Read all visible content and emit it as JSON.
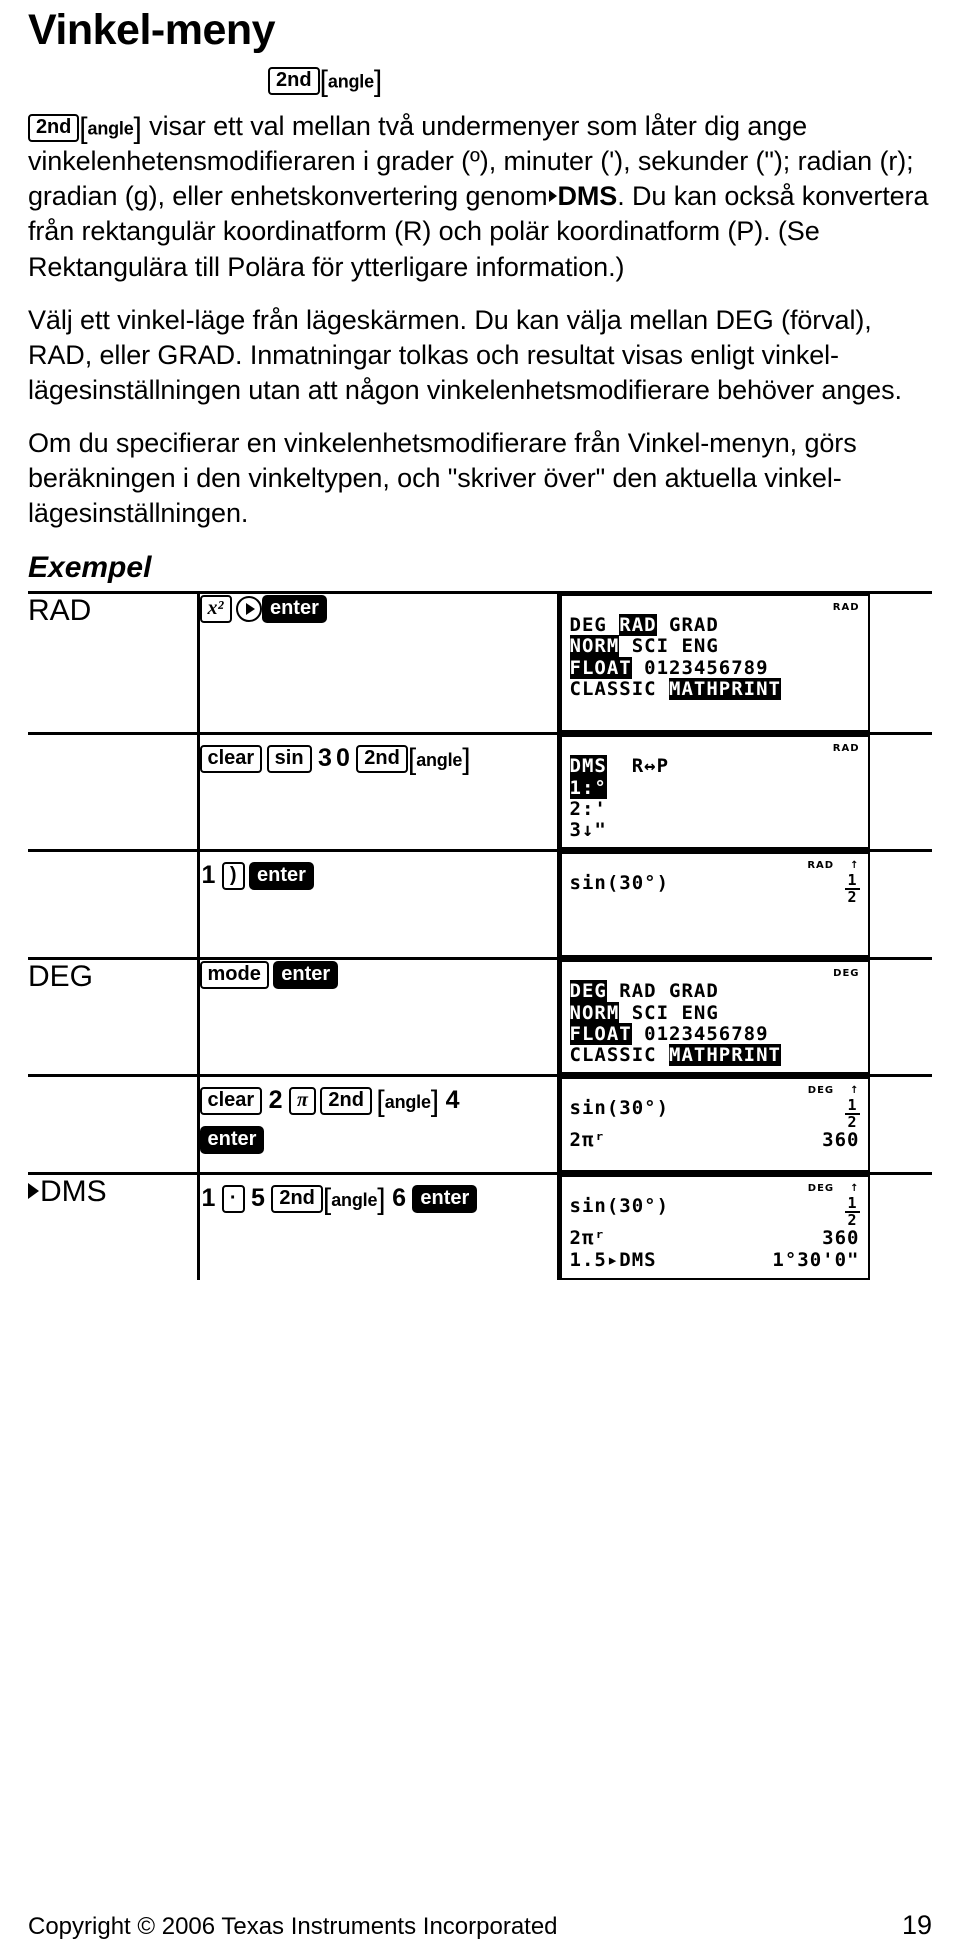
{
  "document": {
    "title": "Vinkel-meny",
    "exempel_heading": "Exempel"
  },
  "keys": {
    "second": "2nd",
    "angle": "angle",
    "x_squared": "x²",
    "enter": "enter",
    "clear": "clear",
    "sin": "sin",
    "mode": "mode",
    "pi": "π",
    "right_paren": ")",
    "decimal_point": "·",
    "digit_3": "3",
    "digit_0": "0",
    "digit_1": "1",
    "digit_2": "2",
    "digit_4": "4",
    "digit_5": "5",
    "digit_6": "6"
  },
  "body": {
    "p1_lead_text": " visar ett val mellan två undermenyer som låter dig ange vinkelenhetensmodifieraren i grader (º), minuter ('), sekunder (\"); radian (r); gradian (g), eller enhetskonvertering genom",
    "p1_dms": "DMS",
    "p1_rest": ". Du kan också konvertera från rektangulär koordinatform (R) och polär koordinatform (P). (Se Rektangulära till Polära för ytterligare information.)",
    "p2": "Välj ett vinkel-läge från lägeskärmen. Du kan välja mellan DEG (förval), RAD, eller GRAD. Inmatningar tolkas och resultat visas enligt vinkel-lägesinställningen utan att någon vinkelenhetsmodifierare behöver anges.",
    "p3": "Om du specifierar en vinkelenhetsmodifierare från Vinkel-menyn, görs beräkningen i den vinkeltypen, och \"skriver över\" den aktuella vinkel-lägesinställningen."
  },
  "examples": {
    "rows": [
      {
        "mode_label": "RAD",
        "keys_label": "x² ▶ enter",
        "screen": {
          "status": "RAD",
          "status_up": "",
          "type": "mode-screen",
          "lines": [
            [
              {
                "t": "DEG ",
                "inv": false
              },
              {
                "t": "RAD",
                "inv": true
              },
              {
                "t": " GRAD",
                "inv": false
              }
            ],
            [
              {
                "t": "NORM",
                "inv": true
              },
              {
                "t": " SCI ENG",
                "inv": false
              }
            ],
            [
              {
                "t": "FLOAT",
                "inv": true
              },
              {
                "t": " 0123456789",
                "inv": false
              }
            ],
            [
              {
                "t": "CLASSIC ",
                "inv": false
              },
              {
                "t": "MATHPRINT",
                "inv": true
              }
            ]
          ]
        }
      },
      {
        "mode_label": "",
        "keys_label": "clear sin 3 0 2nd [angle]",
        "screen": {
          "status": "RAD",
          "status_up": "",
          "type": "menu-screen",
          "lines": [
            [
              {
                "t": "DMS",
                "inv": true
              },
              {
                "t": "  R↔P",
                "inv": false
              }
            ],
            [
              {
                "t": "1:°",
                "inv": true
              }
            ],
            [
              {
                "t": "2:'",
                "inv": false
              }
            ],
            [
              {
                "t": "3↓\"",
                "inv": false
              }
            ]
          ]
        }
      },
      {
        "mode_label": "",
        "keys_label": "1 ) enter",
        "screen": {
          "status": "RAD",
          "status_up": "↑",
          "type": "calc-screen",
          "entries": [
            {
              "expr": "sin(30°)",
              "result_num": "1",
              "result_den": "2",
              "result": ""
            }
          ]
        }
      },
      {
        "mode_label": "DEG",
        "keys_label": "mode enter",
        "screen": {
          "status": "DEG",
          "status_up": "",
          "type": "mode-screen",
          "lines": [
            [
              {
                "t": "DEG",
                "inv": true
              },
              {
                "t": " RAD GRAD",
                "inv": false
              }
            ],
            [
              {
                "t": "NORM",
                "inv": true
              },
              {
                "t": " SCI ENG",
                "inv": false
              }
            ],
            [
              {
                "t": "FLOAT",
                "inv": true
              },
              {
                "t": " 0123456789",
                "inv": false
              }
            ],
            [
              {
                "t": "CLASSIC ",
                "inv": false
              },
              {
                "t": "MATHPRINT",
                "inv": true
              }
            ]
          ]
        }
      },
      {
        "mode_label": "",
        "keys_label": "clear 2 π 2nd [angle] 4 enter",
        "screen": {
          "status": "DEG",
          "status_up": "↑",
          "type": "calc-screen",
          "entries": [
            {
              "expr": "sin(30°)",
              "result_num": "1",
              "result_den": "2",
              "result": ""
            },
            {
              "expr": "2πʳ",
              "result": "360"
            }
          ]
        }
      },
      {
        "mode_label": "▶DMS",
        "keys_label": "1 · 5 2nd [angle] 6 enter",
        "screen": {
          "status": "DEG",
          "status_up": "↑",
          "type": "calc-screen",
          "entries": [
            {
              "expr": "sin(30°)",
              "result_num": "1",
              "result_den": "2",
              "result": ""
            },
            {
              "expr": "2πʳ",
              "result": "360"
            },
            {
              "expr": "1.5▸DMS",
              "result": "1°30'0\""
            }
          ]
        }
      }
    ]
  },
  "footer": {
    "copyright": "Copyright © 2006 Texas Instruments Incorporated",
    "page_number": "19"
  }
}
